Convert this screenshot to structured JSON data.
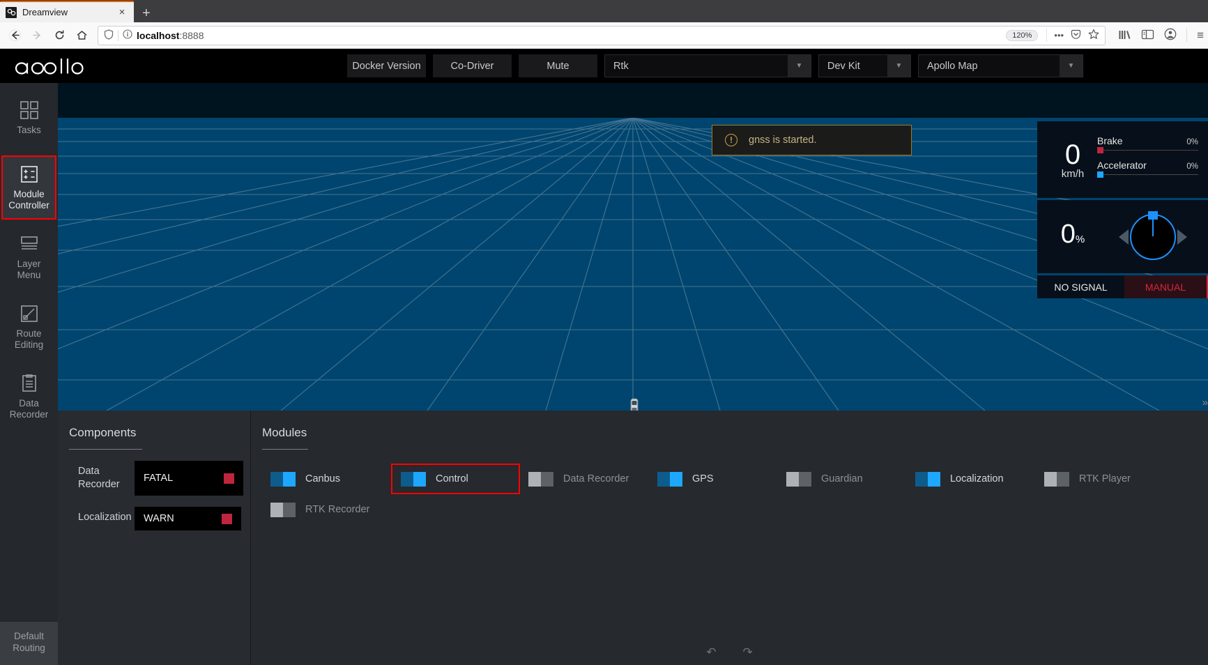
{
  "browser": {
    "tab": {
      "title": "Dreamview",
      "favicon": "dreamview-favicon",
      "close_label": "×"
    },
    "new_tab_label": "+",
    "nav": {
      "back": "←",
      "forward": "→",
      "reload": "↻",
      "home": "⌂"
    },
    "url": {
      "protocol_host": "localhost",
      "port": ":8888",
      "shield": "shield-icon",
      "info": "ⓘ"
    },
    "zoom_level": "120%",
    "icons": {
      "more": "•••",
      "pocket": "pocket-icon",
      "bookmark": "star-icon",
      "library": "library-icon",
      "sidebar": "sidebar-icon",
      "account": "account-icon",
      "menu": "≡"
    }
  },
  "apollo": {
    "logo": "apollo",
    "header": {
      "docker_version": "Docker Version",
      "co_driver": "Co-Driver",
      "mute": "Mute",
      "rtk_select": "Rtk",
      "vehicle_select": "Dev Kit",
      "map_select": "Apollo Map",
      "arrow": "▼"
    },
    "sidebar": {
      "items": [
        {
          "label": "Tasks",
          "icon": "grid-icon",
          "active": false
        },
        {
          "label": "Module\nController",
          "icon": "module-controller-icon",
          "active": true
        },
        {
          "label": "Layer\nMenu",
          "icon": "layers-icon",
          "active": false
        },
        {
          "label": "Route\nEditing",
          "icon": "route-icon",
          "active": false
        },
        {
          "label": "Data\nRecorder",
          "icon": "clipboard-icon",
          "active": false
        }
      ],
      "bottom_label": "Default\nRouting"
    },
    "toast": {
      "icon": "warning-icon",
      "text": "gnss is started."
    },
    "dashboard": {
      "speed_value": "0",
      "speed_unit": "km/h",
      "brake_label": "Brake",
      "brake_pct": "0%",
      "accelerator_label": "Accelerator",
      "accelerator_pct": "0%",
      "throttle_value": "0",
      "throttle_unit": "%",
      "signal_status": "NO SIGNAL",
      "drive_mode": "MANUAL",
      "collapse_icon": "»",
      "colors": {
        "brake": "#d7263d",
        "accelerator": "#1ea7ff",
        "wheel": "#1e90ff",
        "manual": "#d7263d"
      }
    },
    "components": {
      "title": "Components",
      "rows": [
        {
          "name": "Data\nRecorder",
          "status": "FATAL",
          "led": "#c0253f"
        },
        {
          "name": "Localization",
          "status": "WARN",
          "led": "#c0253f"
        }
      ]
    },
    "modules": {
      "title": "Modules",
      "items": [
        {
          "label": "Canbus",
          "on": true,
          "highlight": false
        },
        {
          "label": "Control",
          "on": true,
          "highlight": true
        },
        {
          "label": "Data Recorder",
          "on": false,
          "highlight": false
        },
        {
          "label": "GPS",
          "on": true,
          "highlight": false
        },
        {
          "label": "Guardian",
          "on": false,
          "highlight": false
        },
        {
          "label": "Localization",
          "on": true,
          "highlight": false
        },
        {
          "label": "RTK Player",
          "on": false,
          "highlight": false
        },
        {
          "label": "RTK Recorder",
          "on": false,
          "highlight": false
        }
      ],
      "footer": {
        "undo": "↶",
        "redo": "↷"
      }
    }
  }
}
